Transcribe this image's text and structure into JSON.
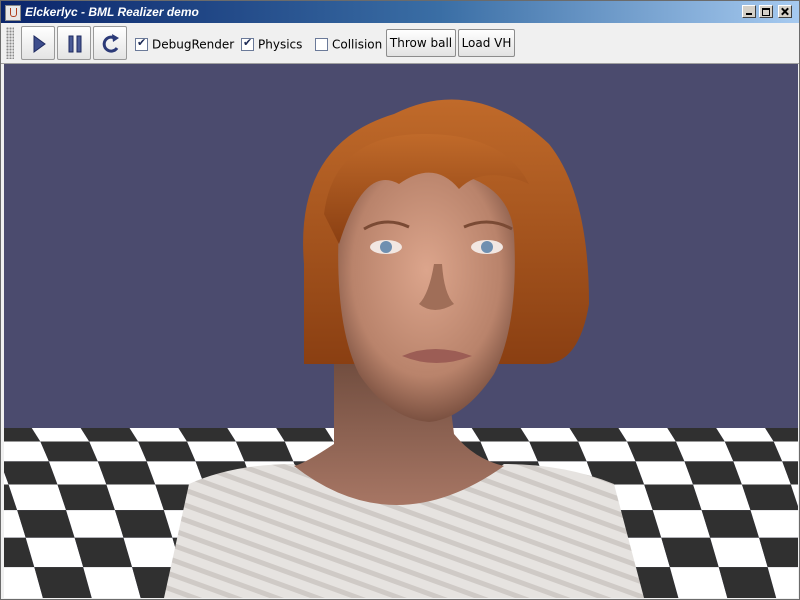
{
  "window": {
    "title": "Elckerlyc - BML Realizer demo"
  },
  "toolbar": {
    "play_icon": "play-icon",
    "pause_icon": "pause-icon",
    "reset_icon": "refresh-icon",
    "checkboxes": [
      {
        "label": "DebugRender",
        "checked": true
      },
      {
        "label": "Physics",
        "checked": true
      },
      {
        "label": "Collision",
        "checked": false
      }
    ],
    "throw_ball_label": "Throw ball",
    "load_vh_label": "Load VH"
  },
  "scene": {
    "background_color": "#4b4b6e",
    "floor_colors": [
      "#ffffff",
      "#303030"
    ]
  }
}
